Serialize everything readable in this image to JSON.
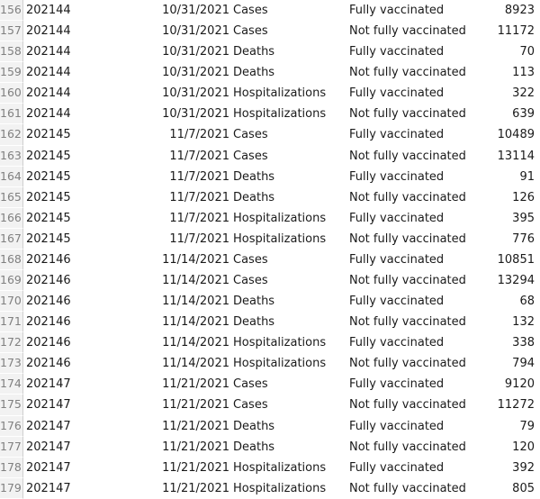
{
  "app": {
    "type": "spreadsheet",
    "row_header_bg": "#f2f2f2",
    "row_header_text_color": "#808080",
    "cell_text_color": "#1a1a1a",
    "grid_line_color": "#cfcfcf",
    "background": "#ffffff"
  },
  "columns": [
    {
      "key": "week",
      "align": "left",
      "name": "week-code"
    },
    {
      "key": "date",
      "align": "right",
      "name": "week-ending-date"
    },
    {
      "key": "metric",
      "align": "left",
      "name": "outcome-metric"
    },
    {
      "key": "status",
      "align": "left",
      "name": "vaccination-status"
    },
    {
      "key": "value",
      "align": "right",
      "name": "count-value"
    }
  ],
  "rows": [
    {
      "num": "156",
      "week": "202144",
      "date": "10/31/2021",
      "metric": "Cases",
      "status": "Fully vaccinated",
      "value": "8923"
    },
    {
      "num": "157",
      "week": "202144",
      "date": "10/31/2021",
      "metric": "Cases",
      "status": "Not fully vaccinated",
      "value": "11172"
    },
    {
      "num": "158",
      "week": "202144",
      "date": "10/31/2021",
      "metric": "Deaths",
      "status": "Fully vaccinated",
      "value": "70"
    },
    {
      "num": "159",
      "week": "202144",
      "date": "10/31/2021",
      "metric": "Deaths",
      "status": "Not fully vaccinated",
      "value": "113"
    },
    {
      "num": "160",
      "week": "202144",
      "date": "10/31/2021",
      "metric": "Hospitalizations",
      "status": "Fully vaccinated",
      "value": "322"
    },
    {
      "num": "161",
      "week": "202144",
      "date": "10/31/2021",
      "metric": "Hospitalizations",
      "status": "Not fully vaccinated",
      "value": "639"
    },
    {
      "num": "162",
      "week": "202145",
      "date": "11/7/2021",
      "metric": "Cases",
      "status": "Fully vaccinated",
      "value": "10489"
    },
    {
      "num": "163",
      "week": "202145",
      "date": "11/7/2021",
      "metric": "Cases",
      "status": "Not fully vaccinated",
      "value": "13114"
    },
    {
      "num": "164",
      "week": "202145",
      "date": "11/7/2021",
      "metric": "Deaths",
      "status": "Fully vaccinated",
      "value": "91"
    },
    {
      "num": "165",
      "week": "202145",
      "date": "11/7/2021",
      "metric": "Deaths",
      "status": "Not fully vaccinated",
      "value": "126"
    },
    {
      "num": "166",
      "week": "202145",
      "date": "11/7/2021",
      "metric": "Hospitalizations",
      "status": "Fully vaccinated",
      "value": "395"
    },
    {
      "num": "167",
      "week": "202145",
      "date": "11/7/2021",
      "metric": "Hospitalizations",
      "status": "Not fully vaccinated",
      "value": "776"
    },
    {
      "num": "168",
      "week": "202146",
      "date": "11/14/2021",
      "metric": "Cases",
      "status": "Fully vaccinated",
      "value": "10851"
    },
    {
      "num": "169",
      "week": "202146",
      "date": "11/14/2021",
      "metric": "Cases",
      "status": "Not fully vaccinated",
      "value": "13294"
    },
    {
      "num": "170",
      "week": "202146",
      "date": "11/14/2021",
      "metric": "Deaths",
      "status": "Fully vaccinated",
      "value": "68"
    },
    {
      "num": "171",
      "week": "202146",
      "date": "11/14/2021",
      "metric": "Deaths",
      "status": "Not fully vaccinated",
      "value": "132"
    },
    {
      "num": "172",
      "week": "202146",
      "date": "11/14/2021",
      "metric": "Hospitalizations",
      "status": "Fully vaccinated",
      "value": "338"
    },
    {
      "num": "173",
      "week": "202146",
      "date": "11/14/2021",
      "metric": "Hospitalizations",
      "status": "Not fully vaccinated",
      "value": "794"
    },
    {
      "num": "174",
      "week": "202147",
      "date": "11/21/2021",
      "metric": "Cases",
      "status": "Fully vaccinated",
      "value": "9120"
    },
    {
      "num": "175",
      "week": "202147",
      "date": "11/21/2021",
      "metric": "Cases",
      "status": "Not fully vaccinated",
      "value": "11272"
    },
    {
      "num": "176",
      "week": "202147",
      "date": "11/21/2021",
      "metric": "Deaths",
      "status": "Fully vaccinated",
      "value": "79"
    },
    {
      "num": "177",
      "week": "202147",
      "date": "11/21/2021",
      "metric": "Deaths",
      "status": "Not fully vaccinated",
      "value": "120"
    },
    {
      "num": "178",
      "week": "202147",
      "date": "11/21/2021",
      "metric": "Hospitalizations",
      "status": "Fully vaccinated",
      "value": "392"
    },
    {
      "num": "179",
      "week": "202147",
      "date": "11/21/2021",
      "metric": "Hospitalizations",
      "status": "Not fully vaccinated",
      "value": "805"
    }
  ]
}
